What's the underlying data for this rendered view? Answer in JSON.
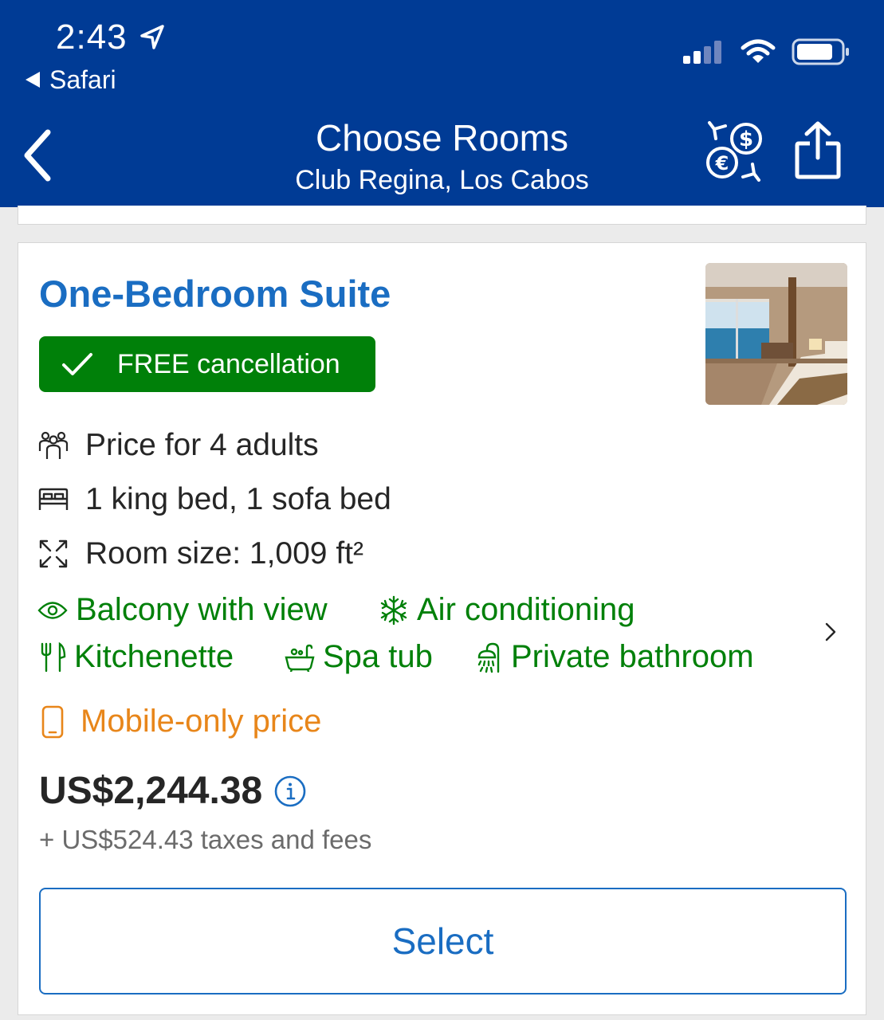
{
  "status_bar": {
    "time": "2:43",
    "back_app": "Safari"
  },
  "header": {
    "title": "Choose Rooms",
    "subtitle": "Club Regina, Los Cabos",
    "icons": [
      "back-chevron-icon",
      "currency-exchange-icon",
      "share-icon"
    ]
  },
  "room": {
    "name": "One-Bedroom Suite",
    "badge": "FREE cancellation",
    "facts": [
      {
        "icon": "guests-icon",
        "text": "Price for 4 adults"
      },
      {
        "icon": "bed-icon",
        "text": "1 king bed, 1 sofa bed"
      },
      {
        "icon": "room-size-icon",
        "text": "Room size: 1,009 ft²"
      }
    ],
    "amenities": [
      {
        "icon": "eye-icon",
        "text": "Balcony with view"
      },
      {
        "icon": "snowflake-icon",
        "text": "Air conditioning"
      },
      {
        "icon": "fork-knife-icon",
        "text": "Kitchenette"
      },
      {
        "icon": "bathtub-icon",
        "text": "Spa tub"
      },
      {
        "icon": "shower-icon",
        "text": "Private bathroom"
      }
    ],
    "mobile_price_label": "Mobile-only price",
    "price": "US$2,244.38",
    "taxes": "+ US$524.43 taxes and fees",
    "select_label": "Select"
  },
  "colors": {
    "header_bg": "#003b95",
    "link_blue": "#1a6dc2",
    "green": "#008009",
    "orange": "#e8861a"
  }
}
